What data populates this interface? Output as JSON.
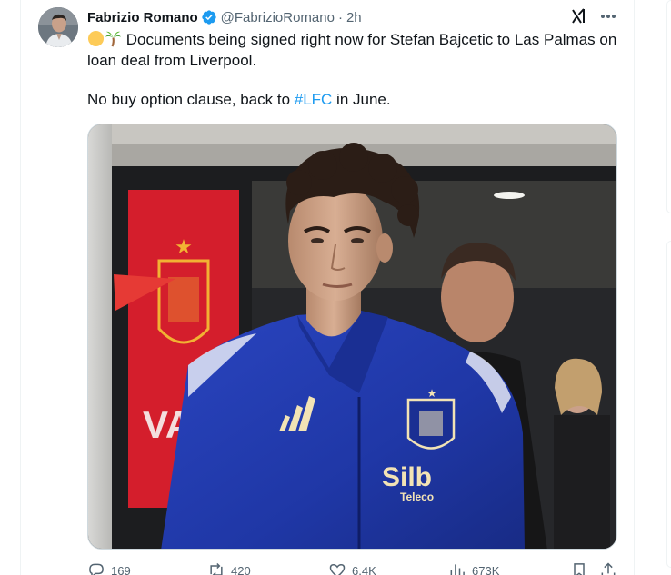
{
  "tweet": {
    "display_name": "Fabrizio Romano",
    "handle": "@FabrizioRomano",
    "separator": "·",
    "time": "2h",
    "text_line1": " Documents being signed right now for Stefan Bajcetic to Las Palmas on loan deal from Liverpool.",
    "text_line2_before": "No buy option clause, back to ",
    "hashtag": "#LFC",
    "text_line2_after": " in June.",
    "emojis": [
      "yellow-circle-emoji",
      "palm-tree-emoji"
    ],
    "icons": {
      "verified": "verified-badge-icon",
      "grok": "grok-icon",
      "more": "more-icon"
    },
    "media": {
      "shirt_brand": "Silb",
      "shirt_sponsor_sub": "Teleco",
      "banner_text": "VAN"
    },
    "actions": {
      "replies": "169",
      "reposts": "420",
      "likes": "6.4K",
      "views": "673K"
    },
    "colors": {
      "accent": "#1d9bf0",
      "text": "#0f1419",
      "secondary": "#536471",
      "jacket": "#1f37a6"
    }
  }
}
